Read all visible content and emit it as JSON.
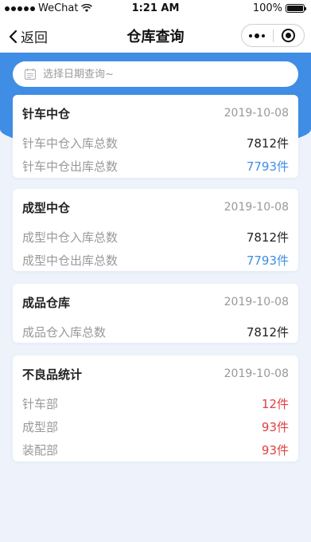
{
  "status_bar": {
    "carrier": "WeChat",
    "time": "1:21 AM",
    "battery": "100%"
  },
  "nav": {
    "back_label": "返回",
    "title": "仓库查询"
  },
  "search": {
    "placeholder": "选择日期查询~"
  },
  "cards": [
    {
      "title": "针车中仓",
      "date": "2019-10-08",
      "rows": [
        {
          "label": "针车中仓入库总数",
          "value": "7812件",
          "color": "#222222"
        },
        {
          "label": "针车中仓出库总数",
          "value": "7793件",
          "color": "#3f8de4"
        }
      ]
    },
    {
      "title": "成型中仓",
      "date": "2019-10-08",
      "rows": [
        {
          "label": "成型中仓入库总数",
          "value": "7812件",
          "color": "#222222"
        },
        {
          "label": "成型中仓出库总数",
          "value": "7793件",
          "color": "#3f8de4"
        }
      ]
    },
    {
      "title": "成品仓库",
      "date": "2019-10-08",
      "rows": [
        {
          "label": "成品仓入库总数",
          "value": "7812件",
          "color": "#222222"
        }
      ]
    },
    {
      "title": "不良品统计",
      "date": "2019-10-08",
      "rows": [
        {
          "label": "针车部",
          "value": "12件",
          "color": "#e04040"
        },
        {
          "label": "成型部",
          "value": "93件",
          "color": "#e04040"
        },
        {
          "label": "装配部",
          "value": "93件",
          "color": "#e04040"
        }
      ]
    }
  ],
  "colors": {
    "accent": "#3f8de4",
    "warning": "#e04040",
    "background": "#eef3fb"
  }
}
